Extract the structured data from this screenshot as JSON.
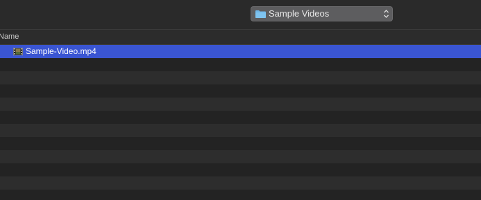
{
  "toolbar": {
    "location": "Sample Videos",
    "folder_icon": "folder-icon",
    "stepper_icon": "up-down-chevron-icon"
  },
  "list": {
    "column_header": "Name",
    "files": [
      {
        "name": "Sample-Video.mp4",
        "icon": "video-file-icon",
        "selected": true
      }
    ]
  },
  "colors": {
    "selection": "#3a55d2",
    "folder": "#6fb7e8"
  }
}
